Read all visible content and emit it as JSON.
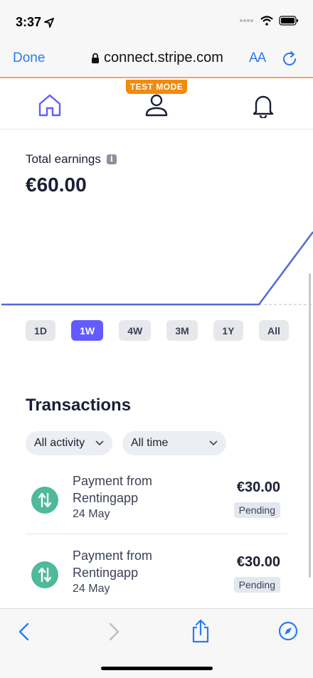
{
  "status_bar": {
    "time": "3:37",
    "icons": [
      "location-arrow-icon",
      "signal-dots-icon",
      "wifi-icon",
      "battery-icon"
    ]
  },
  "browser": {
    "done_label": "Done",
    "url": "connect.stripe.com",
    "text_size_label": "AA",
    "icons": [
      "lock-icon",
      "reload-icon"
    ],
    "accent_color": "#2b7bf0"
  },
  "app_nav": {
    "test_mode_label": "TEST MODE",
    "test_mode_color": "#f28b0c",
    "icons": [
      "home-icon",
      "profile-icon",
      "bell-icon"
    ],
    "active_color": "#635bff"
  },
  "earnings": {
    "label": "Total earnings",
    "value": "€60.00"
  },
  "chart_data": {
    "type": "line",
    "x": [
      0,
      1,
      2,
      3,
      4,
      5,
      6,
      7
    ],
    "values": [
      0,
      0,
      0,
      0,
      0,
      0,
      0,
      60
    ],
    "title": "",
    "xlabel": "",
    "ylabel": "",
    "color": "#5469d4"
  },
  "ranges": [
    {
      "label": "1D",
      "active": false
    },
    {
      "label": "1W",
      "active": true
    },
    {
      "label": "4W",
      "active": false
    },
    {
      "label": "3M",
      "active": false
    },
    {
      "label": "1Y",
      "active": false
    },
    {
      "label": "All",
      "active": false
    }
  ],
  "transactions": {
    "title": "Transactions",
    "filters": [
      "All activity",
      "All time"
    ],
    "items": [
      {
        "desc": "Payment from Rentingapp",
        "date": "24 May",
        "amount": "€30.00",
        "status": "Pending"
      },
      {
        "desc": "Payment from Rentingapp",
        "date": "24 May",
        "amount": "€30.00",
        "status": "Pending"
      }
    ]
  },
  "toolbar": {
    "icons": [
      "back-icon",
      "forward-icon",
      "share-icon",
      "compass-icon"
    ]
  }
}
